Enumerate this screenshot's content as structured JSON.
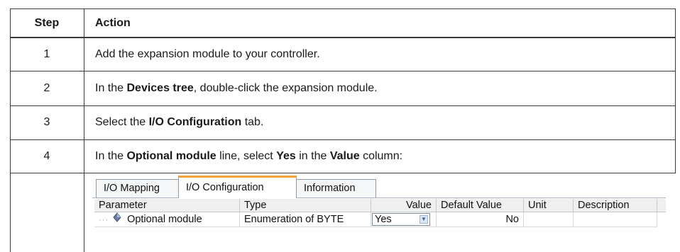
{
  "table": {
    "header_step": "Step",
    "header_action": "Action",
    "rows": [
      {
        "step": "1",
        "action": "Add the expansion module to your controller."
      },
      {
        "step": "2",
        "pre": "In the ",
        "bold": "Devices tree",
        "post": ", double-click the expansion module."
      },
      {
        "step": "3",
        "pre": "Select the ",
        "bold": "I/O Configuration",
        "post": " tab."
      },
      {
        "step": "4",
        "t1": "In the ",
        "b1": "Optional module",
        "t2": " line, select ",
        "b2": "Yes",
        "t3": " in the ",
        "b3": "Value",
        "t4": " column:"
      }
    ]
  },
  "screenshot": {
    "tabs": [
      "I/O Mapping",
      "I/O Configuration",
      "Information"
    ],
    "active_tab": "I/O Configuration",
    "columns": [
      "Parameter",
      "Type",
      "Value",
      "Default Value",
      "Unit",
      "Description"
    ],
    "row": {
      "parameter": "Optional module",
      "type": "Enumeration of BYTE",
      "value": "Yes",
      "default_value": "No",
      "unit": "",
      "description": ""
    },
    "tree_connector": "···",
    "param_icon": "module-diamond-icon",
    "accent_color": "#f2a33a"
  }
}
